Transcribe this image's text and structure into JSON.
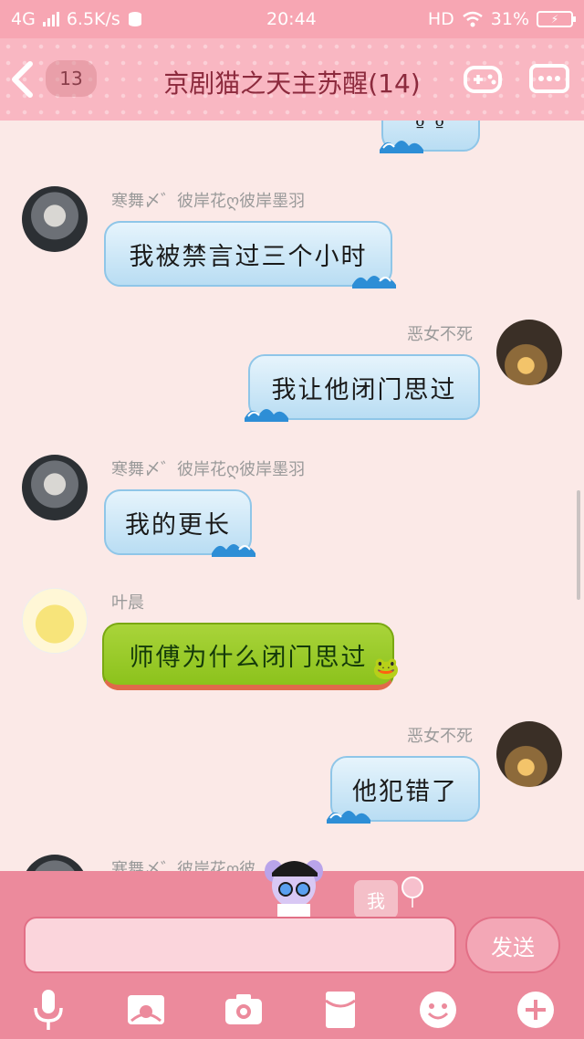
{
  "status_bar": {
    "network": "4G",
    "speed": "6.5K/s",
    "time": "20:44",
    "hd": "HD",
    "battery": "31%"
  },
  "header": {
    "unread_count": "13",
    "title": "京剧猫之天主苏醒(14)"
  },
  "messages": [
    {
      "side": "left",
      "sender": "寒舞〆゛彼岸花ღ彼岸墨羽",
      "text": "我被禁言过三个小时",
      "avatar": "doll"
    },
    {
      "side": "right",
      "sender": "恶女不死",
      "text": "我让他闭门思过",
      "avatar": "sunset"
    },
    {
      "side": "left",
      "sender": "寒舞〆゛彼岸花ღ彼岸墨羽",
      "text": "我的更长",
      "avatar": "doll"
    },
    {
      "side": "left",
      "sender": "叶晨",
      "text": "师傅为什么闭门思过",
      "avatar": "pikachu"
    },
    {
      "side": "right",
      "sender": "恶女不死",
      "text": "他犯错了",
      "avatar": "sunset"
    },
    {
      "side": "left",
      "sender": "寒舞〆゛彼岸花ღ彼",
      "text": "",
      "avatar": "doll"
    }
  ],
  "input": {
    "me_label": "我",
    "placeholder": "",
    "send_label": "发送"
  },
  "toolbar": [
    "microphone-icon",
    "picture-icon",
    "camera-icon",
    "red-packet-icon",
    "emoji-icon",
    "plus-icon"
  ],
  "colors": {
    "status_bar": "#f7a6b3",
    "title_bar": "#f9b7c2",
    "title_text": "#8c2a3d",
    "bubble_blue": "#b9ddf3",
    "bubble_green": "#8cc21c",
    "panel": "#ec8a9c"
  }
}
